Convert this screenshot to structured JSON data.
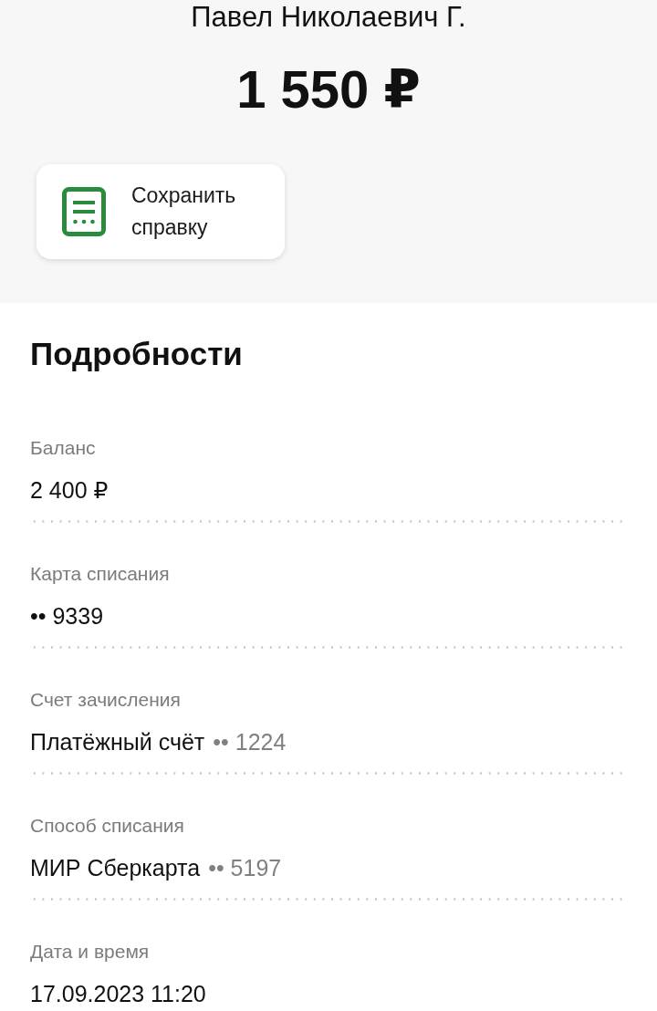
{
  "header": {
    "recipient": "Павел Николаевич Г.",
    "amount": "1 550 ₽"
  },
  "save_button": {
    "label": "Сохранить справку"
  },
  "details": {
    "title": "Подробности",
    "rows": [
      {
        "label": "Баланс",
        "value": "2 400 ₽"
      },
      {
        "label": "Карта списания",
        "value": "•• 9339"
      },
      {
        "label": "Счет зачисления",
        "value": "Платёжный счёт",
        "detail": "•• 1224"
      },
      {
        "label": "Способ списания",
        "value": "МИР Сберкарта",
        "detail": "•• 5197"
      },
      {
        "label": "Дата и время",
        "value": "17.09.2023 11:20"
      }
    ]
  }
}
